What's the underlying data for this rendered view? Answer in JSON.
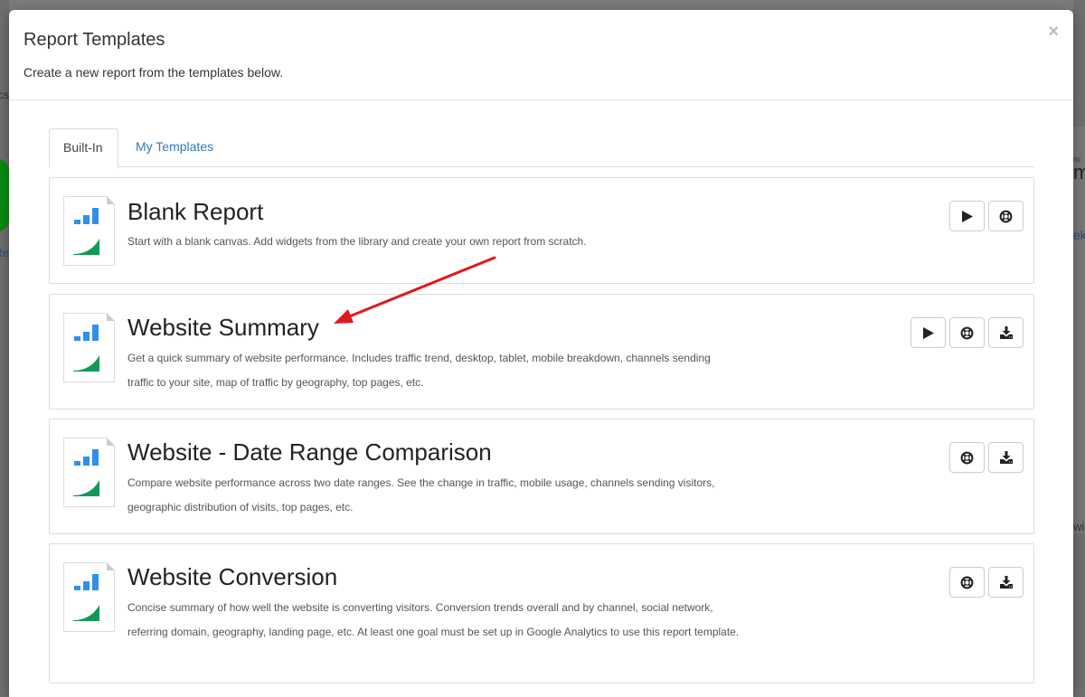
{
  "background": {
    "left_fragment_1": "cs",
    "left_fragment_2": "Re",
    "right_fragment_1": "ric",
    "right_fragment_2": "m",
    "right_fragment_3": "ek",
    "right_fragment_4": "wi"
  },
  "modal": {
    "title": "Report Templates",
    "subtitle": "Create a new report from the templates below.",
    "close_icon": "×"
  },
  "tabs": [
    {
      "label": "Built-In",
      "active": true
    },
    {
      "label": "My Templates",
      "active": false
    }
  ],
  "templates": [
    {
      "title": "Blank Report",
      "description": "Start with a blank canvas. Add widgets from the library and create your own report from scratch.",
      "actions": [
        "play",
        "help"
      ]
    },
    {
      "title": "Website Summary",
      "description": "Get a quick summary of website performance. Includes traffic trend, desktop, tablet, mobile breakdown, channels sending traffic to your site, map of traffic by geography, top pages, etc.",
      "actions": [
        "play",
        "help",
        "download"
      ]
    },
    {
      "title": "Website - Date Range Comparison",
      "description": "Compare website performance across two date ranges. See the change in traffic, mobile usage, channels sending visitors, geographic distribution of visits, top pages, etc.",
      "actions": [
        "help",
        "download"
      ]
    },
    {
      "title": "Website Conversion",
      "description": "Concise summary of how well the website is converting visitors. Conversion trends overall and by channel, social network, referring domain, geography, landing page, etc. At least one goal must be set up in Google Analytics to use this report template.",
      "actions": [
        "help",
        "download"
      ]
    }
  ],
  "annotation": {
    "type": "arrow",
    "color": "#e0191c",
    "points_to": "Website Summary"
  },
  "colors": {
    "link": "#337ab7",
    "icon_bars": "#2f8ef0",
    "icon_area": "#119a55"
  }
}
